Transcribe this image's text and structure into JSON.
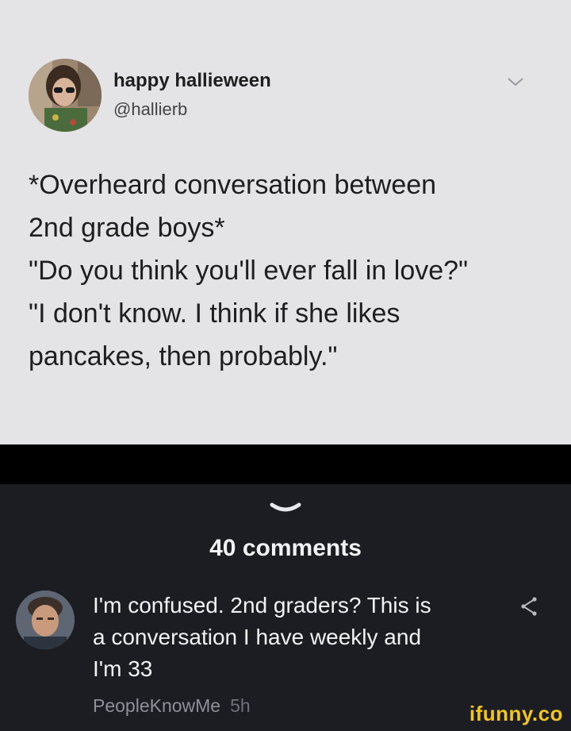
{
  "tweet": {
    "display_name": "happy hallieween",
    "handle": "@hallierb",
    "lines": [
      "*Overheard conversation between",
      "2nd grade boys*",
      "\"Do you think you'll ever fall in love?\"",
      "\"I don't know. I think if she likes",
      "pancakes, then probably.\""
    ]
  },
  "comments": {
    "count_label": "40 comments",
    "top_comment": {
      "lines": [
        "I'm confused. 2nd graders? This is",
        "a conversation I have weekly and",
        "I'm 33"
      ],
      "author": "PeopleKnowMe",
      "time": "5h"
    }
  },
  "watermark": "ifunny.co",
  "colors": {
    "tweet_bg": "#e4e4e6",
    "panel_bg": "#1c1d22",
    "watermark": "#f2c51f"
  }
}
